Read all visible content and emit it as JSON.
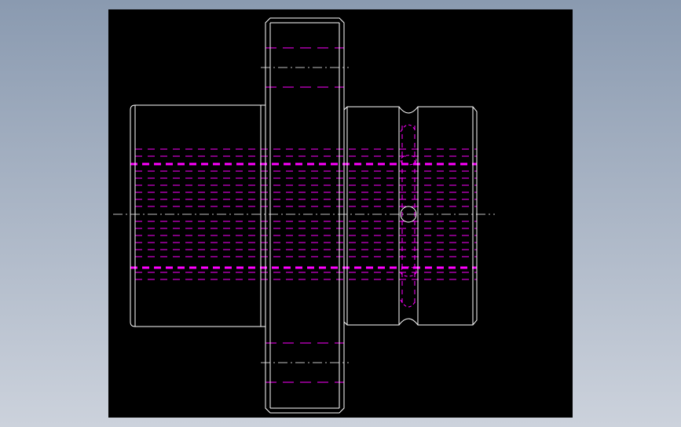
{
  "colors": {
    "background_top": "#8a9ab0",
    "background_bottom": "#ccd2dc",
    "canvas": "#000000",
    "outline": "#ffffff",
    "hidden_line": "#ff00ff",
    "center_line": "#ffffff"
  },
  "drawing": {
    "view": "front-elevation",
    "parts": [
      "left-hub",
      "gear-disk",
      "right-hub",
      "groove-collar"
    ],
    "hidden_lines": "dashed-magenta",
    "center_lines": "dash-dot-white"
  }
}
